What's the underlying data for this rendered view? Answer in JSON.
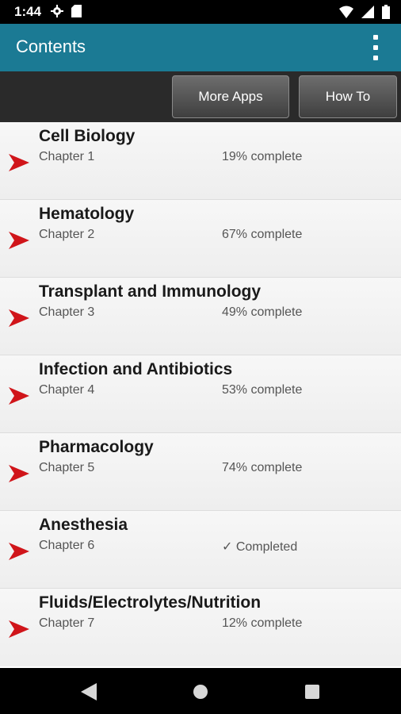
{
  "status_bar": {
    "time": "1:44",
    "left_icons": [
      "gear-icon",
      "sd-card-icon"
    ],
    "right_icons": [
      "wifi-icon",
      "signal-icon",
      "battery-icon"
    ]
  },
  "app_bar": {
    "title": "Contents",
    "background": "#1b7a94"
  },
  "toolbar": {
    "more_apps_label": "More Apps",
    "how_to_label": "How To"
  },
  "chapters": [
    {
      "title": "Cell Biology",
      "chapter": "Chapter 1",
      "status": "19% complete"
    },
    {
      "title": "Hematology",
      "chapter": "Chapter 2",
      "status": "67% complete"
    },
    {
      "title": "Transplant and Immunology",
      "chapter": "Chapter 3",
      "status": "49% complete"
    },
    {
      "title": "Infection and Antibiotics",
      "chapter": "Chapter 4",
      "status": "53% complete"
    },
    {
      "title": "Pharmacology",
      "chapter": "Chapter 5",
      "status": "74% complete"
    },
    {
      "title": "Anesthesia",
      "chapter": "Chapter 6",
      "status": "✓ Completed"
    },
    {
      "title": "Fluids/Electrolytes/Nutrition",
      "chapter": "Chapter 7",
      "status": "12% complete"
    }
  ],
  "colors": {
    "arrow": "#d0151a"
  },
  "nav_bar": {
    "icons": [
      "back-icon",
      "home-icon",
      "recents-icon"
    ]
  }
}
